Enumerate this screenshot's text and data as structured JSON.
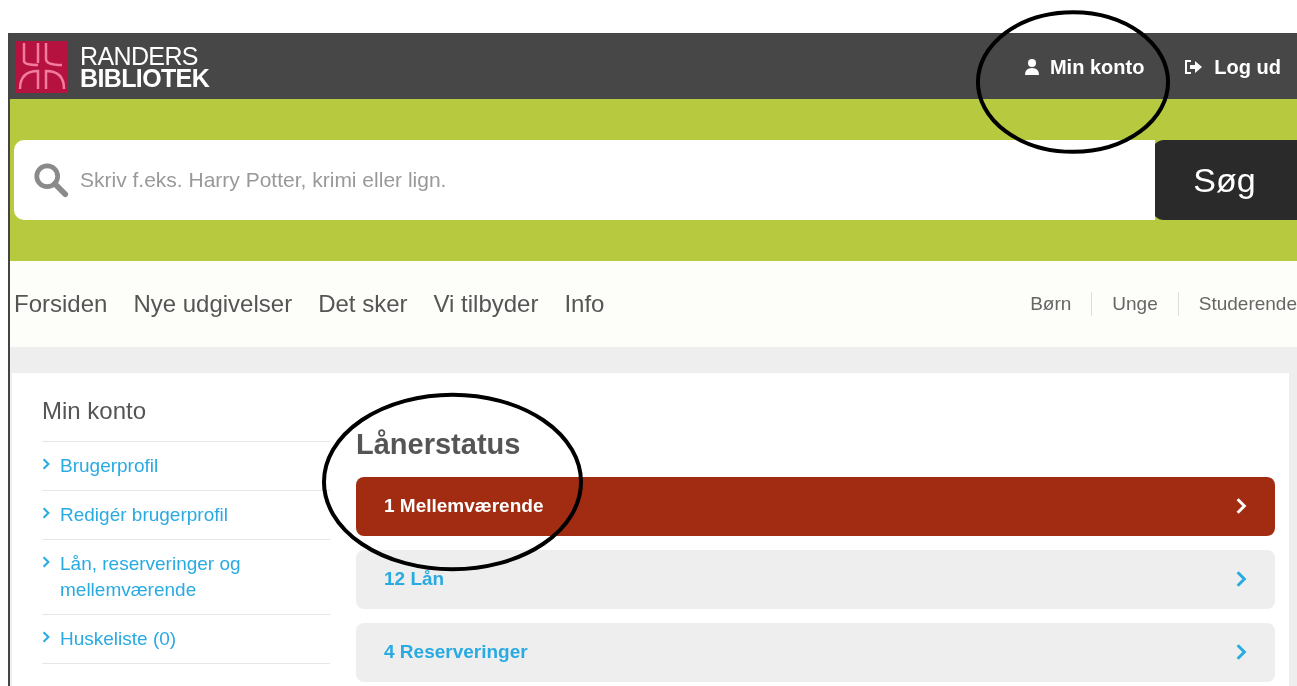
{
  "logo": {
    "line_1": "RANDERS",
    "line_2": "BIBLIOTEK"
  },
  "top_links": [
    {
      "label": "Min konto",
      "kind": "user"
    },
    {
      "label": "Log ud",
      "kind": "logout"
    }
  ],
  "search": {
    "placeholder": "Skriv f.eks. Harry Potter, krimi eller lign.",
    "button": "Søg"
  },
  "main_nav": [
    "Forsiden",
    "Nye udgivelser",
    "Det sker",
    "Vi tilbyder",
    "Info"
  ],
  "audience_nav": [
    "Børn",
    "Unge",
    "Studerende"
  ],
  "sidebar": {
    "title": "Min konto",
    "items": [
      "Brugerprofil",
      "Redigér brugerprofil",
      "Lån, reserveringer og mellemværende",
      "Huskeliste (0)"
    ]
  },
  "main": {
    "title": "Lånerstatus",
    "items": [
      {
        "label": "1 Mellemværende",
        "kind": "alert"
      },
      {
        "label": "12 Lån",
        "kind": "normal"
      },
      {
        "label": "4 Reserveringer",
        "kind": "normal"
      }
    ]
  }
}
